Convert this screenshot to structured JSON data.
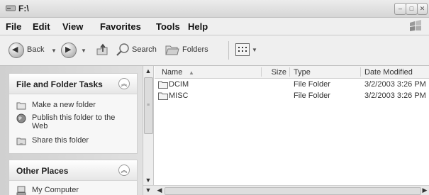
{
  "window": {
    "title": "F:\\"
  },
  "menu": [
    "File",
    "Edit",
    "View",
    "Favorites",
    "Tools",
    "Help"
  ],
  "toolbar": {
    "back_label": "Back",
    "search_label": "Search",
    "folders_label": "Folders"
  },
  "tasks_panel": {
    "title": "File and Folder Tasks",
    "items": [
      {
        "label": "Make a new folder",
        "icon": "new-folder-icon"
      },
      {
        "label": "Publish this folder to the Web",
        "icon": "globe-icon"
      },
      {
        "label": "Share this folder",
        "icon": "share-icon"
      }
    ]
  },
  "places_panel": {
    "title": "Other Places",
    "items": [
      {
        "label": "My Computer",
        "icon": "computer-icon"
      }
    ]
  },
  "list": {
    "columns": [
      "Name",
      "Size",
      "Type",
      "Date Modified"
    ],
    "rows": [
      {
        "name": "DCIM",
        "size": "",
        "type": "File Folder",
        "modified": "3/2/2003 3:26 PM"
      },
      {
        "name": "MISC",
        "size": "",
        "type": "File Folder",
        "modified": "3/2/2003 3:26 PM"
      }
    ]
  }
}
